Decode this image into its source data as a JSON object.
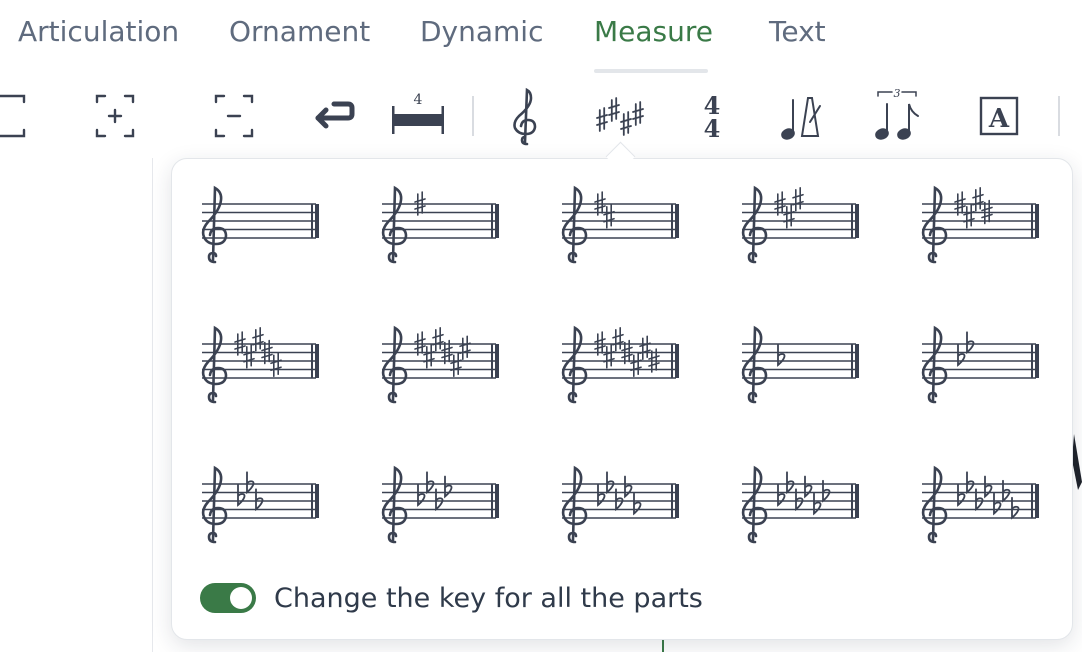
{
  "tabs": [
    {
      "label": "Articulation",
      "active": false
    },
    {
      "label": "Ornament",
      "active": false
    },
    {
      "label": "Dynamic",
      "active": false
    },
    {
      "label": "Measure",
      "active": true
    },
    {
      "label": "Text",
      "active": false
    }
  ],
  "toolbar": {
    "icons": [
      "measure-bracket-icon",
      "add-measure-icon",
      "remove-measure-icon",
      "line-break-icon",
      "multimeasure-rest-icon",
      "clef-icon",
      "key-signature-icon",
      "time-signature-icon",
      "tempo-icon",
      "tuplet-icon",
      "text-box-icon"
    ],
    "rest_count": "4",
    "time_signature": {
      "top": "4",
      "bottom": "4"
    },
    "tuplet_number": "3",
    "text_box_letter": "A"
  },
  "key_signatures": [
    {
      "accidental": "sharp",
      "count": 0
    },
    {
      "accidental": "sharp",
      "count": 1
    },
    {
      "accidental": "sharp",
      "count": 2
    },
    {
      "accidental": "sharp",
      "count": 3
    },
    {
      "accidental": "sharp",
      "count": 4
    },
    {
      "accidental": "sharp",
      "count": 5
    },
    {
      "accidental": "sharp",
      "count": 6
    },
    {
      "accidental": "sharp",
      "count": 7
    },
    {
      "accidental": "flat",
      "count": 1
    },
    {
      "accidental": "flat",
      "count": 2
    },
    {
      "accidental": "flat",
      "count": 3
    },
    {
      "accidental": "flat",
      "count": 4
    },
    {
      "accidental": "flat",
      "count": 5
    },
    {
      "accidental": "flat",
      "count": 6
    },
    {
      "accidental": "flat",
      "count": 7
    }
  ],
  "toggle": {
    "label": "Change the key for all the parts",
    "on": true
  },
  "colors": {
    "accent": "#3a7a47",
    "ink": "#3b4252",
    "tab_text": "#5f6b7e"
  }
}
